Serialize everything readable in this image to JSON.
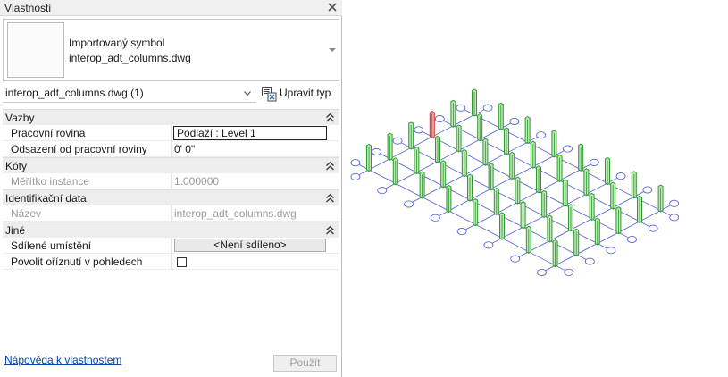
{
  "panel": {
    "title": "Vlastnosti",
    "type_line1": "Importovaný symbol",
    "type_line2": "interop_adt_columns.dwg",
    "instance_selector": "interop_adt_columns.dwg (1)",
    "edit_type_label": "Upravit typ"
  },
  "groups": {
    "constraints": {
      "label": "Vazby",
      "work_plane_name": "Pracovní rovina",
      "work_plane_value": "Podlaží : Level 1",
      "offset_name": "Odsazení od pracovní roviny",
      "offset_value": "0'  0\""
    },
    "dimensions": {
      "label": "Kóty",
      "scale_name": "Měřítko instance",
      "scale_value": "1.000000"
    },
    "identity": {
      "label": "Identifikační data",
      "name_name": "Název",
      "name_value": "interop_adt_columns.dwg"
    },
    "other": {
      "label": "Jiné",
      "shared_name": "Sdílené umístění",
      "shared_value": "<Není sdíleno>",
      "crop_name": "Povolit oříznutí v pohledech",
      "crop_checked": false
    }
  },
  "footer": {
    "help_link": "Nápověda k vlastnostem",
    "apply_label": "Použít"
  },
  "colors": {
    "grid_line": "#4a5bd8",
    "column_green": "#2e9a2e",
    "column_green_light": "#bfe8b8",
    "column_selected": "#d23030",
    "column_selected_light": "#f3b3b3",
    "link": "#0645ad"
  },
  "viewport": {
    "grid_columns": 8,
    "grid_rows": 6,
    "selected_column": [
      0,
      3
    ]
  }
}
